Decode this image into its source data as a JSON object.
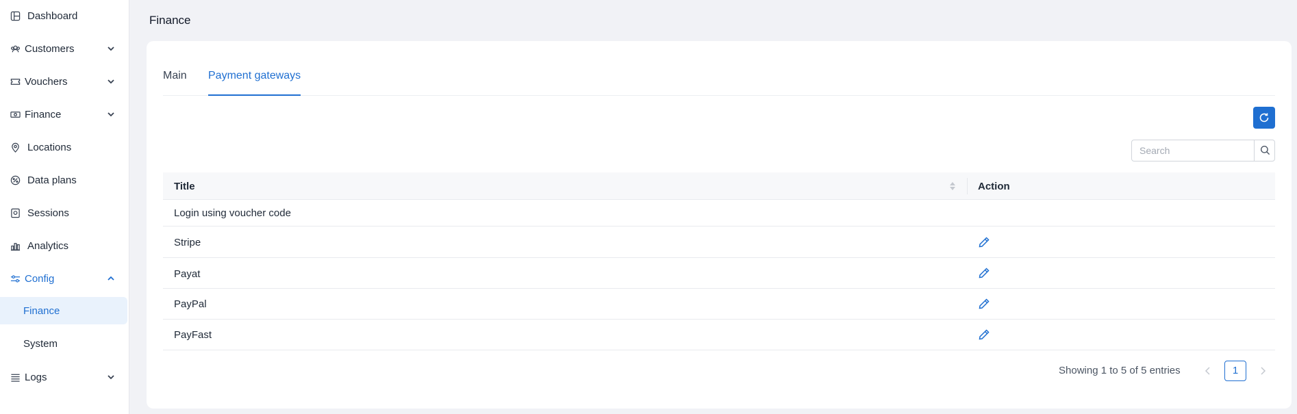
{
  "sidebar": {
    "items": [
      {
        "label": "Dashboard",
        "icon": "dashboard-icon"
      },
      {
        "label": "Customers",
        "icon": "customers-icon"
      },
      {
        "label": "Vouchers",
        "icon": "voucher-icon"
      },
      {
        "label": "Finance",
        "icon": "money-icon"
      },
      {
        "label": "Locations",
        "icon": "location-pin-icon"
      },
      {
        "label": "Data plans",
        "icon": "data-plans-icon"
      },
      {
        "label": "Sessions",
        "icon": "sessions-icon"
      },
      {
        "label": "Analytics",
        "icon": "analytics-icon"
      },
      {
        "label": "Config",
        "icon": "sliders-icon"
      },
      {
        "label": "Logs",
        "icon": "list-icon"
      }
    ],
    "config_sub": [
      {
        "label": "Finance",
        "selected": true
      },
      {
        "label": "System",
        "selected": false
      }
    ]
  },
  "header": {
    "title": "Finance"
  },
  "tabs": [
    {
      "label": "Main",
      "active": false
    },
    {
      "label": "Payment gateways",
      "active": true
    }
  ],
  "search": {
    "placeholder": "Search",
    "value": ""
  },
  "table": {
    "columns": [
      "Title",
      "Action"
    ],
    "rows": [
      {
        "title": "Login using voucher code",
        "editable": false
      },
      {
        "title": "Stripe",
        "editable": true
      },
      {
        "title": "Payat",
        "editable": true
      },
      {
        "title": "PayPal",
        "editable": true
      },
      {
        "title": "PayFast",
        "editable": true
      }
    ]
  },
  "pagination": {
    "summary": "Showing 1 to 5 of 5 entries",
    "current_page": "1"
  },
  "colors": {
    "accent": "#1f6fd1",
    "selected_bg": "#e9f2fc",
    "page_bg": "#f1f2f6"
  }
}
